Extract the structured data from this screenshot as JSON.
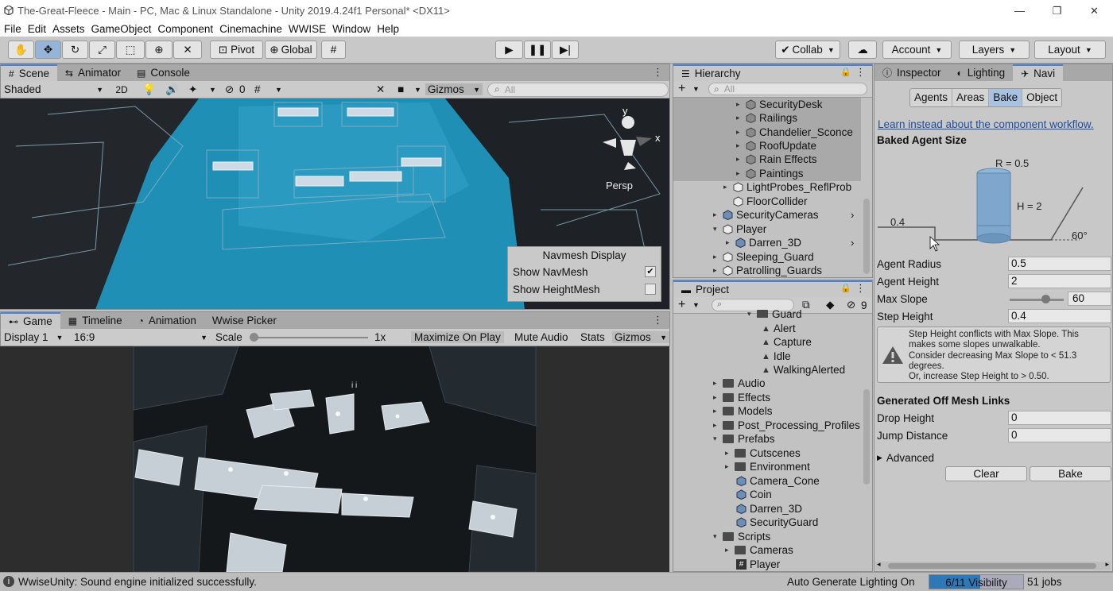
{
  "window": {
    "title": "The-Great-Fleece - Main - PC, Mac & Linux Standalone - Unity 2019.4.24f1 Personal* <DX11>",
    "minimize": "—",
    "maximize": "❐",
    "close": "✕"
  },
  "menu": [
    "File",
    "Edit",
    "Assets",
    "GameObject",
    "Component",
    "Cinemachine",
    "WWISE",
    "Window",
    "Help"
  ],
  "toolbar": {
    "pivot": "Pivot",
    "global": "Global",
    "collab": "Collab",
    "account": "Account",
    "layers": "Layers",
    "layout": "Layout"
  },
  "scene_panel": {
    "tabs": [
      "Scene",
      "Animator",
      "Console"
    ],
    "shading_mode": "Shaded",
    "mode_2d": "2D",
    "hidden_count": "0",
    "gizmos": "Gizmos",
    "search_placeholder": "All",
    "persp_label": "Persp",
    "axis_y": "y",
    "axis_x": "x",
    "navmesh_overlay": {
      "title": "Navmesh Display",
      "show_navmesh": "Show NavMesh",
      "show_heightmesh": "Show HeightMesh",
      "show_navmesh_checked": true,
      "show_heightmesh_checked": false
    }
  },
  "game_panel": {
    "tabs": [
      "Game",
      "Timeline",
      "Animation",
      "Wwise Picker"
    ],
    "display": "Display 1",
    "aspect": "16:9",
    "scale_label": "Scale",
    "scale_value": "1x",
    "maximize_on_play": "Maximize On Play",
    "mute_audio": "Mute Audio",
    "stats": "Stats",
    "gizmos": "Gizmos",
    "overlay_mark": "i i"
  },
  "hierarchy": {
    "tab": "Hierarchy",
    "search_placeholder": "All",
    "items": [
      "SecurityDesk",
      "Railings",
      "Chandelier_Sconce",
      "RoofUpdate",
      "Rain Effects",
      "Paintings",
      "LightProbes_ReflProb",
      "FloorCollider",
      "SecurityCameras",
      "Player",
      "Darren_3D",
      "Sleeping_Guard",
      "Patrolling_Guards"
    ]
  },
  "project": {
    "tab": "Project",
    "hidden_count": "9",
    "items": [
      "Guard",
      "Alert",
      "Capture",
      "Idle",
      "WalkingAlerted",
      "Audio",
      "Effects",
      "Models",
      "Post_Processing_Profiles",
      "Prefabs",
      "Cutscenes",
      "Environment",
      "Camera_Cone",
      "Coin",
      "Darren_3D",
      "SecurityGuard",
      "Scripts",
      "Cameras",
      "Player"
    ]
  },
  "inspector": {
    "tabs": [
      "Inspector",
      "Lighting",
      "Navi"
    ],
    "nav_tabs": [
      "Agents",
      "Areas",
      "Bake",
      "Object"
    ],
    "active_nav_tab": "Bake",
    "component_workflow_link": "Learn instead about the component workflow.",
    "baked_agent_size": "Baked Agent Size",
    "diagram": {
      "r_label": "R = 0.5",
      "h_label": "H = 2",
      "step_label": "0.4",
      "slope_label": "60°"
    },
    "agent_radius_label": "Agent Radius",
    "agent_radius": "0.5",
    "agent_height_label": "Agent Height",
    "agent_height": "2",
    "max_slope_label": "Max Slope",
    "max_slope": "60",
    "max_slope_fraction": 0.667,
    "step_height_label": "Step Height",
    "step_height": "0.4",
    "warning_line1": "Step Height conflicts with Max Slope. This",
    "warning_line2": "makes some slopes unwalkable.",
    "warning_line3": "Consider decreasing Max Slope to < 51.3",
    "warning_line4": "degrees.",
    "warning_line5": "Or, increase Step Height to > 0.50.",
    "off_mesh_links": "Generated Off Mesh Links",
    "drop_height_label": "Drop Height",
    "drop_height": "0",
    "jump_distance_label": "Jump Distance",
    "jump_distance": "0",
    "advanced": "Advanced",
    "clear_button": "Clear",
    "bake_button": "Bake"
  },
  "status": {
    "message": "WwiseUnity: Sound engine initialized successfully.",
    "auto_generate": "Auto Generate Lighting On",
    "progress_text": "6/11 Visibility",
    "progress_fraction": 0.545,
    "jobs": "51 jobs"
  },
  "colors": {
    "accent": "#4a83d8",
    "navmesh": "#1f8fb5",
    "warning_bg": "#d2d2d2"
  }
}
